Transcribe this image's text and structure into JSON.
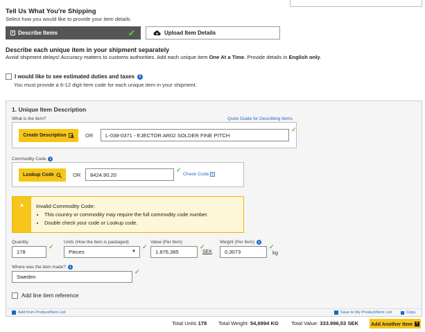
{
  "header": {
    "title": "Tell Us What You're Shipping",
    "subtitle": "Select how you would like to provide your item details"
  },
  "modes": {
    "describe_label": "Describe Items",
    "upload_label": "Upload Item Details"
  },
  "describe_section": {
    "title": "Describe each unique item in your shipment separately",
    "note_prefix": "Avoid shipment delays! Accuracy matters to customs authorities.  Add each unique item ",
    "note_bold1": "One At a Time",
    "note_mid": ".  Provide details in ",
    "note_bold2": "English only",
    "note_suffix": "."
  },
  "duties": {
    "label": "I would like to see estimated duties and taxes",
    "subtext": "You must provide a 6-12 digit item code for each unique item in your shipment."
  },
  "item": {
    "section_title": "1. Unique Item Description",
    "what_label": "What is the item?",
    "quick_guide_link": "Quick Guide for Describing Items",
    "create_button": "Create Description",
    "or_text": "OR",
    "description_value": "L-038-0371 - EJECTOR AR02 SOLDER FINE PITCH",
    "commodity_label": "Commodity Code",
    "lookup_button": "Lookup Code",
    "commodity_value": "8424.90.20",
    "check_code_link": "Check Code"
  },
  "warning": {
    "title": "Invalid Commodity Code:",
    "items": [
      "This country or commodity may require the full commodity code number.",
      "Double check your code or Lookup code."
    ]
  },
  "fields": {
    "quantity_label": "Quantity",
    "quantity_value": "178",
    "units_label": "Units (How the item is packaged)",
    "units_value": "Pieces",
    "value_label": "Value (Per Item)",
    "value_value": "1.876,385",
    "currency": "SEK",
    "weight_label": "Weight (Per Item)",
    "weight_value": "0,3073",
    "weight_unit": "kg",
    "origin_label": "Where was the item made?",
    "origin_value": "Sweden",
    "line_ref_label": "Add line item reference"
  },
  "footer_links": {
    "add_from_list": "Add from Product/Item List",
    "save_to_list": "Save to My Product/Item List",
    "copy": "Copy"
  },
  "totals": {
    "units_label": "Total Units",
    "units_value": "178",
    "weight_label": "Total Weight:",
    "weight_value": "54,6994 KG",
    "value_label": "Total Value:",
    "value_value": "333.996,53 SEK",
    "add_button": "Add Another Item"
  },
  "colors": {
    "accent_yellow": "#f7c51a",
    "link_blue": "#1c67c6",
    "success_green": "#5fbf2a",
    "dark_gray": "#555555"
  }
}
